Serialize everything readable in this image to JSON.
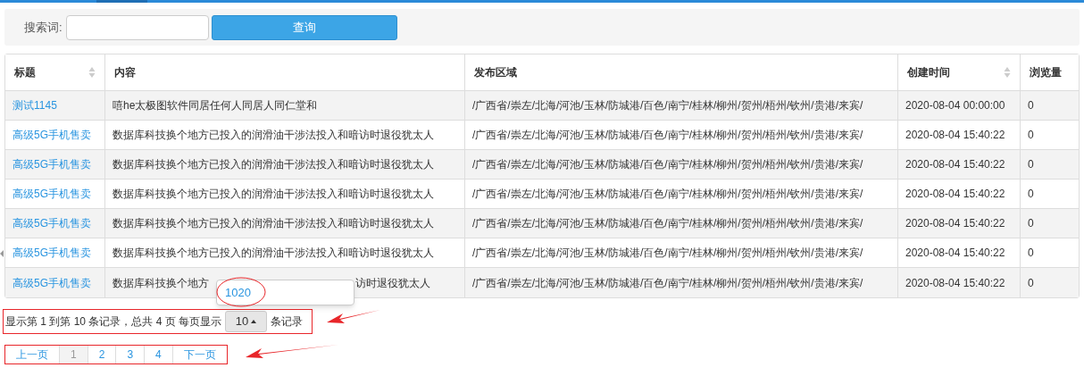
{
  "search": {
    "label": "搜索词:",
    "button": "查询"
  },
  "table": {
    "columns": [
      {
        "label": "标题",
        "sortable": true
      },
      {
        "label": "内容",
        "sortable": false
      },
      {
        "label": "发布区域",
        "sortable": false
      },
      {
        "label": "创建时间",
        "sortable": true
      },
      {
        "label": "浏览量",
        "sortable": false
      }
    ],
    "rows": [
      [
        "测试1145",
        "嘻he太极图软件同居任何人同居人同仁堂和",
        "/广西省/崇左/北海/河池/玉林/防城港/百色/南宁/桂林/柳州/贺州/梧州/钦州/贵港/来宾/",
        "2020-08-04 00:00:00",
        "0"
      ],
      [
        "高级5G手机售卖",
        "数据库科技换个地方已投入的润滑油干涉法投入和暗访时退役犹太人",
        "/广西省/崇左/北海/河池/玉林/防城港/百色/南宁/桂林/柳州/贺州/梧州/钦州/贵港/来宾/",
        "2020-08-04 15:40:22",
        "0"
      ],
      [
        "高级5G手机售卖",
        "数据库科技换个地方已投入的润滑油干涉法投入和暗访时退役犹太人",
        "/广西省/崇左/北海/河池/玉林/防城港/百色/南宁/桂林/柳州/贺州/梧州/钦州/贵港/来宾/",
        "2020-08-04 15:40:22",
        "0"
      ],
      [
        "高级5G手机售卖",
        "数据库科技换个地方已投入的润滑油干涉法投入和暗访时退役犹太人",
        "/广西省/崇左/北海/河池/玉林/防城港/百色/南宁/桂林/柳州/贺州/梧州/钦州/贵港/来宾/",
        "2020-08-04 15:40:22",
        "0"
      ],
      [
        "高级5G手机售卖",
        "数据库科技换个地方已投入的润滑油干涉法投入和暗访时退役犹太人",
        "/广西省/崇左/北海/河池/玉林/防城港/百色/南宁/桂林/柳州/贺州/梧州/钦州/贵港/来宾/",
        "2020-08-04 15:40:22",
        "0"
      ],
      [
        "高级5G手机售卖",
        "数据库科技换个地方已投入的润滑油干涉法投入和暗访时退役犹太人",
        "/广西省/崇左/北海/河池/玉林/防城港/百色/南宁/桂林/柳州/贺州/梧州/钦州/贵港/来宾/",
        "2020-08-04 15:40:22",
        "0"
      ],
      [
        "高级5G手机售卖",
        [
          "数据库科技换个地方",
          "访时退役犹太人"
        ],
        "/广西省/崇左/北海/河池/玉林/防城港/百色/南宁/桂林/柳州/贺州/梧州/钦州/贵港/来宾/",
        "2020-08-04 15:40:22",
        "0"
      ]
    ]
  },
  "page_size_menu": {
    "options": [
      "1020"
    ]
  },
  "pagination_info": {
    "before": "显示第 1 到第 10 条记录，总共 4 页  每页显示",
    "page_size": "10",
    "after": "条记录"
  },
  "pages": [
    {
      "label": "上一页",
      "selected": false
    },
    {
      "label": "1",
      "selected": true
    },
    {
      "label": "2",
      "selected": false
    },
    {
      "label": "3",
      "selected": false
    },
    {
      "label": "4",
      "selected": false
    },
    {
      "label": "下一页",
      "selected": false
    }
  ]
}
